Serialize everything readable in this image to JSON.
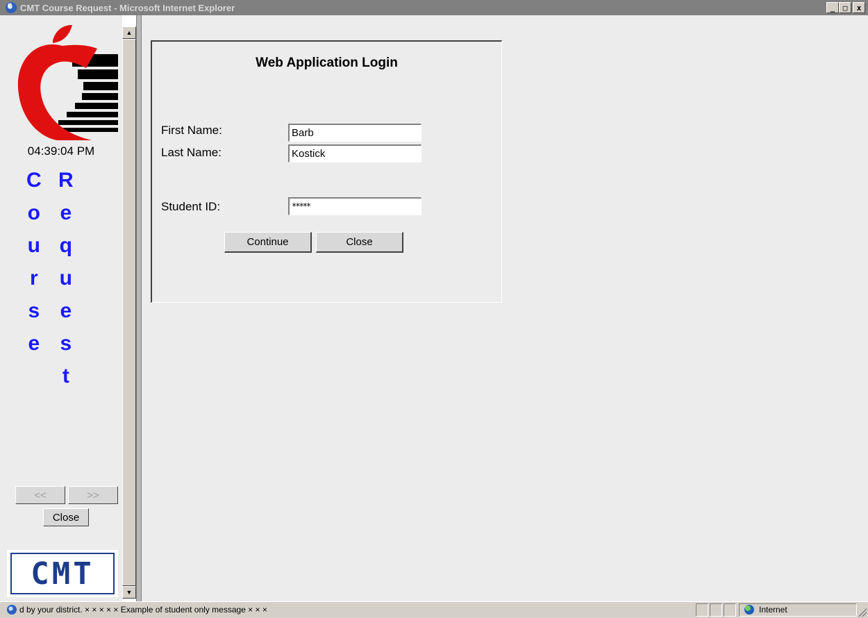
{
  "window": {
    "title": "CMT Course Request - Microsoft Internet Explorer",
    "minimize": "_",
    "maximize": "□",
    "close": "x"
  },
  "sidebar": {
    "clock": "04:39:04 PM",
    "course_letters": [
      "C",
      "o",
      "u",
      "r",
      "s",
      "e"
    ],
    "request_letters": [
      "R",
      "e",
      "q",
      "u",
      "e",
      "s",
      "t"
    ],
    "prev_label": "<<",
    "next_label": ">>",
    "close_label": "Close",
    "logo_text": "CMT"
  },
  "login": {
    "title": "Web Application Login",
    "first_name_label": "First Name:",
    "first_name_value": "Barb",
    "last_name_label": "Last Name:",
    "last_name_value": "Kostick",
    "student_id_label": "Student ID:",
    "student_id_value": "*****",
    "continue_label": "Continue",
    "close_label": "Close"
  },
  "statusbar": {
    "message": "d by your district.   ×    ×    ×    ×    ×     Example of student only message    ×    ×    ×",
    "zone": "Internet"
  },
  "colors": {
    "title_bar": "#808080",
    "heading_letters": "#1a1aff",
    "apple_red": "#e01010",
    "cmt_blue": "#1c3c8c"
  }
}
